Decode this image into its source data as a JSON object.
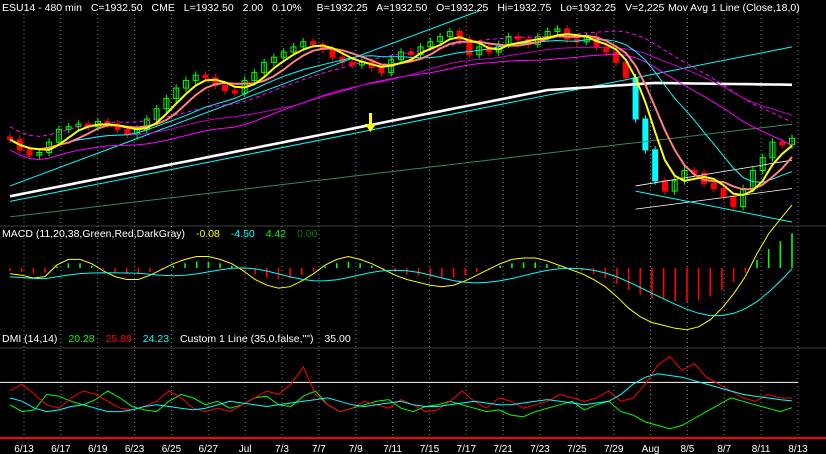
{
  "header": {
    "symbol": "ESU14 - 480 min",
    "close": "C=1932.50",
    "exchange": "CME",
    "last": "L=1932.50",
    "change": "2.00",
    "change_pct": "0.10%",
    "bid": "B=1932.25",
    "ask": "A=1932.50",
    "open": "O=1932.25",
    "high": "Hi=1932.75",
    "low": "Lo=1932.25",
    "volume": "V=2,225",
    "indicator": "Mov Avg 1 Line (Close,18,0)"
  },
  "macd_header": {
    "label": "MACD (11,20,38,Green,Red,DarkGray)",
    "v1": "-0.08",
    "v2": "-4.50",
    "v3": "4.42",
    "v4": "0.00"
  },
  "dmi_header": {
    "label": "DMI (14,14)",
    "v1": "20.28",
    "v2": "25.89",
    "v3": "24.23",
    "custom": "Custom 1 Line (35,0,false,\"\")",
    "custom_val": "35.00"
  },
  "colors": {
    "background": "#000000",
    "up_bar": "#00ff00",
    "down_bar": "#ff0000",
    "ma_fast": "#ffff00",
    "ma_salmon": "#ff8080",
    "ma_slow": "#ffffff",
    "cyan": "#00ffff",
    "magenta": "#ff00ff",
    "grid": "#808080",
    "axis": "#ff0000"
  },
  "chart_data": [
    {
      "type": "candlestick",
      "title": "ESU14 - 480 min",
      "x_ticks": [
        "6/13",
        "6/17",
        "6/19",
        "6/23",
        "6/25",
        "6/27",
        "Jul",
        "7/3",
        "7/7",
        "7/9",
        "7/11",
        "7/15",
        "7/17",
        "7/21",
        "7/23",
        "7/25",
        "7/29",
        "Aug",
        "8/5",
        "8/7",
        "8/11",
        "8/13"
      ],
      "close": [
        1932,
        1928,
        1926,
        1927,
        1931,
        1936,
        1937,
        1938,
        1937,
        1939,
        1938,
        1936,
        1934,
        1936,
        1940,
        1944,
        1948,
        1952,
        1955,
        1957,
        1956,
        1953,
        1951,
        1950,
        1955,
        1958,
        1962,
        1964,
        1966,
        1968,
        1970,
        1969,
        1967,
        1964,
        1962,
        1961,
        1962,
        1960,
        1958,
        1963,
        1966,
        1965,
        1968,
        1970,
        1972,
        1974,
        1971,
        1965,
        1968,
        1966,
        1969,
        1972,
        1971,
        1969,
        1972,
        1974,
        1975,
        1971,
        1970,
        1972,
        1968,
        1966,
        1962,
        1956,
        1940,
        1928,
        1916,
        1912,
        1916,
        1920,
        1919,
        1915,
        1913,
        1910,
        1906,
        1913,
        1920,
        1925,
        1931,
        1930,
        1932.5
      ],
      "ma18_last": 1932.25,
      "down_arrow_at": "7/11"
    },
    {
      "type": "bar+line",
      "title": "MACD (11,20,38,Green,Red,DarkGray)",
      "macd_values": [
        -0.4,
        -0.5,
        -0.7,
        -0.6,
        0.2,
        0.6,
        0.6,
        0.3,
        -0.2,
        -0.6,
        -0.8,
        -0.8,
        -0.5,
        -0.1,
        0.3,
        0.6,
        0.8,
        0.8,
        0.6,
        0.3,
        -0.2,
        -0.8,
        -1.2,
        -1.4,
        -1.3,
        -0.9,
        -0.4,
        0.2,
        0.6,
        0.8,
        0.6,
        0.3,
        -0.1,
        -0.5,
        -0.8,
        -1.0,
        -1.2,
        -1.3,
        -1.2,
        -0.9,
        -0.5,
        -0.1,
        0.3,
        0.6,
        0.7,
        0.7,
        0.5,
        0.2,
        -0.1,
        -0.4,
        -0.8,
        -1.3,
        -2.0,
        -2.8,
        -3.4,
        -3.8,
        -4.0,
        -4.2,
        -4.3,
        -4.1,
        -3.6,
        -2.8,
        -1.8,
        -0.6,
        1.0,
        2.4,
        3.4,
        4.4
      ],
      "values": [
        "-0.08",
        "-4.50",
        "4.42",
        "0.00"
      ]
    },
    {
      "type": "line",
      "title": "DMI (14,14)",
      "series": [
        {
          "name": "20.28",
          "values": [
            22,
            18,
            19,
            28,
            27,
            24,
            22,
            25,
            30,
            26,
            21,
            19,
            18,
            24,
            28,
            26,
            22,
            24,
            20,
            22,
            26,
            27,
            22,
            21,
            27,
            30,
            22,
            18,
            20,
            22,
            24,
            25,
            20,
            18,
            21,
            22,
            24,
            22,
            20,
            18,
            19,
            16,
            15,
            18,
            20,
            22,
            24,
            19,
            22,
            24,
            18,
            16,
            12,
            10,
            8,
            10,
            14,
            18,
            22,
            26,
            24,
            22,
            20,
            18,
            20.28
          ]
        },
        {
          "name": "25.89",
          "values": [
            30,
            34,
            28,
            22,
            20,
            26,
            30,
            28,
            24,
            20,
            19,
            21,
            24,
            30,
            26,
            20,
            18,
            20,
            18,
            22,
            26,
            30,
            28,
            34,
            44,
            28,
            22,
            18,
            20,
            24,
            22,
            20,
            25,
            22,
            18,
            19,
            24,
            30,
            24,
            20,
            26,
            24,
            20,
            22,
            24,
            28,
            26,
            24,
            26,
            30,
            24,
            26,
            34,
            45,
            50,
            42,
            46,
            38,
            34,
            30,
            26,
            24,
            28,
            26,
            25.89
          ]
        },
        {
          "name": "24.23",
          "values": [
            26,
            24,
            20,
            18,
            19,
            21,
            22,
            20,
            18,
            18,
            19,
            21,
            22,
            21,
            20,
            19,
            20,
            22,
            24,
            23,
            22,
            21,
            22,
            23,
            24,
            25,
            26,
            24,
            22,
            21,
            22,
            23,
            24,
            22,
            21,
            21,
            22,
            23,
            24,
            23,
            22,
            22,
            23,
            24,
            25,
            24,
            23,
            22,
            23,
            24,
            28,
            34,
            38,
            40,
            39,
            38,
            36,
            34,
            32,
            30,
            28,
            27,
            26,
            25,
            24.23
          ]
        }
      ],
      "reference_line": 35
    }
  ]
}
